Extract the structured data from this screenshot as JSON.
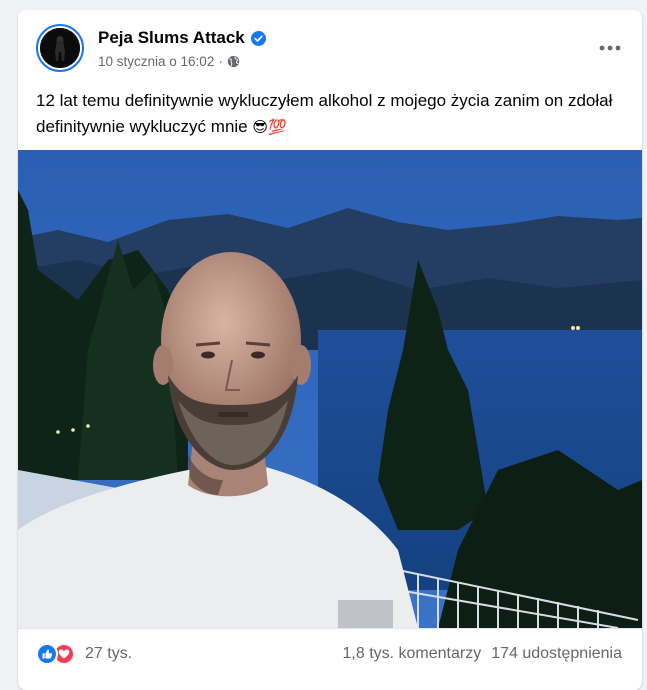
{
  "post": {
    "author": "Peja Slums Attack",
    "date": "10 stycznia o 16:02",
    "separator": "·",
    "text": "12 lat temu definitywnie wykluczyłem alkohol z mojego życia zanim on zdołał definitywnie wykluczyć mnie",
    "text_emojis": "😎💯",
    "more_label": "•••"
  },
  "footer": {
    "reaction_count": "27 tys.",
    "comments": "1,8 tys. komentarzy",
    "shares": "174 udostępnienia"
  },
  "icons": {
    "verified": "verified-badge-icon",
    "audience": "globe-icon",
    "menu": "more-options-icon",
    "like": "like-reaction-icon",
    "love": "love-reaction-icon"
  },
  "colors": {
    "brand": "#1877f2",
    "love": "#f33e58",
    "secondary_text": "#65676b"
  }
}
